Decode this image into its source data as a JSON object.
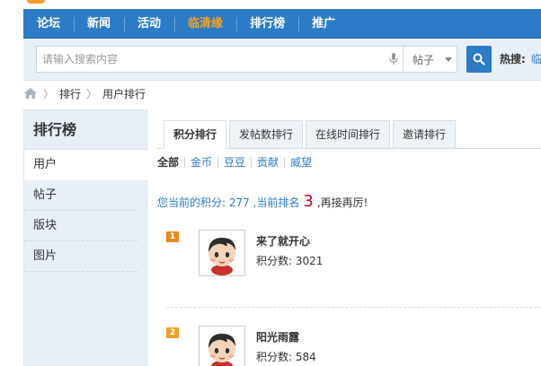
{
  "nav": {
    "items": [
      {
        "label": "论坛",
        "active": false
      },
      {
        "label": "新闻",
        "active": false
      },
      {
        "label": "活动",
        "active": false
      },
      {
        "label": "临清缘",
        "active": true
      },
      {
        "label": "排行榜",
        "active": false
      },
      {
        "label": "推广",
        "active": false
      }
    ]
  },
  "search": {
    "placeholder": "请输入搜索内容",
    "value": "",
    "type_selected": "帖子",
    "hot_label": "热搜:",
    "hot_link": "临"
  },
  "breadcrumb": [
    "排行",
    "用户排行"
  ],
  "sidebar": {
    "title": "排行榜",
    "items": [
      {
        "label": "用户",
        "active": true
      },
      {
        "label": "帖子",
        "active": false
      },
      {
        "label": "版块",
        "active": false
      },
      {
        "label": "图片",
        "active": false
      }
    ]
  },
  "tabs": [
    {
      "label": "积分排行",
      "active": true
    },
    {
      "label": "发帖数排行",
      "active": false
    },
    {
      "label": "在线时间排行",
      "active": false
    },
    {
      "label": "邀请排行",
      "active": false
    }
  ],
  "filters": [
    "全部",
    "金币",
    "豆豆",
    "贡献",
    "威望"
  ],
  "score_line": {
    "prefix": "您当前的积分: 277 ,当前排名",
    "rank": "3",
    "suffix": ",再接再厉!"
  },
  "ranking": [
    {
      "badge": "1",
      "name": "来了就开心",
      "score": "积分数: 3021"
    },
    {
      "badge": "2",
      "name": "阳光雨露",
      "score": "积分数: 584"
    }
  ],
  "colors": {
    "nav_bg": "#2b7bc7",
    "nav_active": "#f7a21a",
    "link": "#2b7bc7",
    "rank_red": "#d0021b",
    "badge": "#e8891c"
  }
}
